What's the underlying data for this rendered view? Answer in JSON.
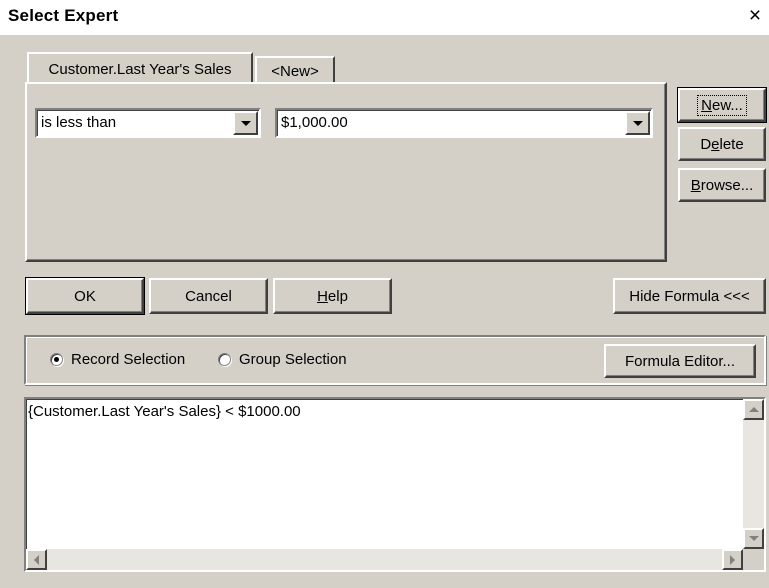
{
  "window": {
    "title": "Select Expert",
    "close_glyph": "×"
  },
  "tabs": [
    {
      "label": "Customer.Last Year's Sales"
    },
    {
      "label": "<New>"
    }
  ],
  "criteria": {
    "operator": "is less than",
    "value": "$1,000.00"
  },
  "side_buttons": {
    "new_pre": "",
    "new_u": "N",
    "new_post": "ew...",
    "delete_pre": "D",
    "delete_u": "e",
    "delete_post": "lete",
    "browse_pre": "",
    "browse_u": "B",
    "browse_post": "rowse..."
  },
  "actions": {
    "ok": "OK",
    "cancel": "Cancel",
    "help_u": "H",
    "help_post": "elp",
    "hide_formula": "Hide Formula <<<"
  },
  "selection": {
    "record": "Record Selection",
    "group": "Group Selection",
    "selected": "record",
    "formula_editor": "Formula Editor..."
  },
  "formula": {
    "text": "{Customer.Last Year's Sales} < $1000.00"
  }
}
